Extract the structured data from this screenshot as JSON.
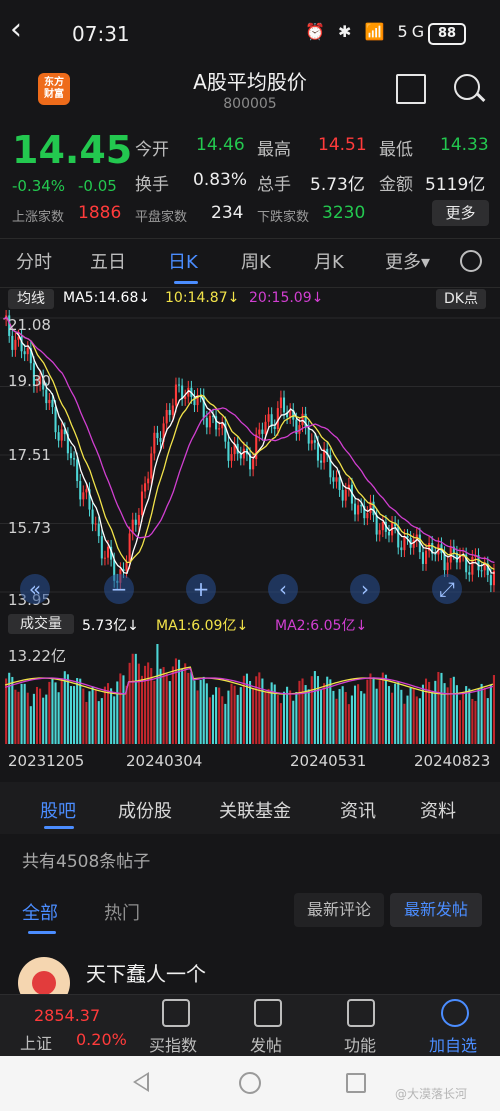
{
  "status_bar": {
    "time": "07:31",
    "icons": "⏰ ✱ 📶 5G",
    "battery": "88"
  },
  "header": {
    "logo_line1": "东方",
    "logo_line2": "财富",
    "title": "A股平均股价",
    "code": "800005"
  },
  "quote": {
    "price": "14.45",
    "change_pct": "-0.34%",
    "change": "-0.05",
    "open_label": "今开",
    "open": "14.46",
    "high_label": "最高",
    "high": "14.51",
    "low_label": "最低",
    "low": "14.33",
    "turnover_label": "换手",
    "turnover": "0.83%",
    "volume_label": "总手",
    "volume": "5.73亿",
    "amount_label": "金额",
    "amount": "5119亿",
    "up_label": "上涨家数",
    "up_count": "1886",
    "flat_label": "平盘家数",
    "flat_count": "234",
    "down_label": "下跌家数",
    "down_count": "3230",
    "more_btn": "更多"
  },
  "period_tabs": [
    "分时",
    "五日",
    "日K",
    "周K",
    "月K",
    "更多▾"
  ],
  "ma_bar": {
    "type_btn": "均线",
    "ma5": "MA5:14.68↓",
    "ma10": "10:14.87↓",
    "ma20": "20:15.09↓",
    "dk_btn": "DK点"
  },
  "price_axis": [
    "21.08",
    "19.30",
    "17.51",
    "15.73",
    "13.95"
  ],
  "volume_bar": {
    "type_btn": "成交量",
    "vol": "5.73亿↓",
    "ma1": "MA1:6.09亿↓",
    "ma2": "MA2:6.05亿↓",
    "axis_max": "13.22亿"
  },
  "dates": [
    "20231205",
    "20240304",
    "20240531",
    "20240823"
  ],
  "section_tabs": [
    "股吧",
    "成份股",
    "关联基金",
    "资讯",
    "资料"
  ],
  "posts": {
    "count_text": "共有4508条帖子",
    "filter_all": "全部",
    "filter_hot": "热门",
    "sort_latest_comment": "最新评论",
    "sort_latest_post": "最新发帖",
    "first_user": "天下蠢人一个"
  },
  "bottom_bar": {
    "index_value": "2854.37",
    "index_name": "上证",
    "index_pct": "0.20%",
    "buy_index": "买指数",
    "post": "发帖",
    "function": "功能",
    "add_watch": "加自选"
  },
  "watermark": "@大漠落长河",
  "colors": {
    "up": "#ff3b3b",
    "down": "#23c84f",
    "accent": "#4b8dff",
    "ma5": "#ffffff",
    "ma10": "#f2e34a",
    "ma20": "#d13fd1",
    "candle_down": "#4dd6d6"
  },
  "chart_data": {
    "type": "candlestick",
    "series_ma": [
      "MA5",
      "MA10",
      "MA20"
    ],
    "ylim": [
      13.95,
      21.08
    ],
    "close_trend": [
      20.9,
      20.4,
      19.6,
      18.6,
      17.6,
      16.4,
      15.2,
      14.2,
      15.6,
      17.4,
      18.6,
      19.3,
      18.8,
      18.3,
      17.6,
      17.4,
      18.3,
      18.7,
      18.4,
      17.8,
      17.1,
      16.4,
      16.1,
      15.7,
      15.4,
      15.2,
      15.0,
      14.9,
      14.8,
      14.6,
      14.45
    ],
    "volume_max": "13.22亿"
  }
}
